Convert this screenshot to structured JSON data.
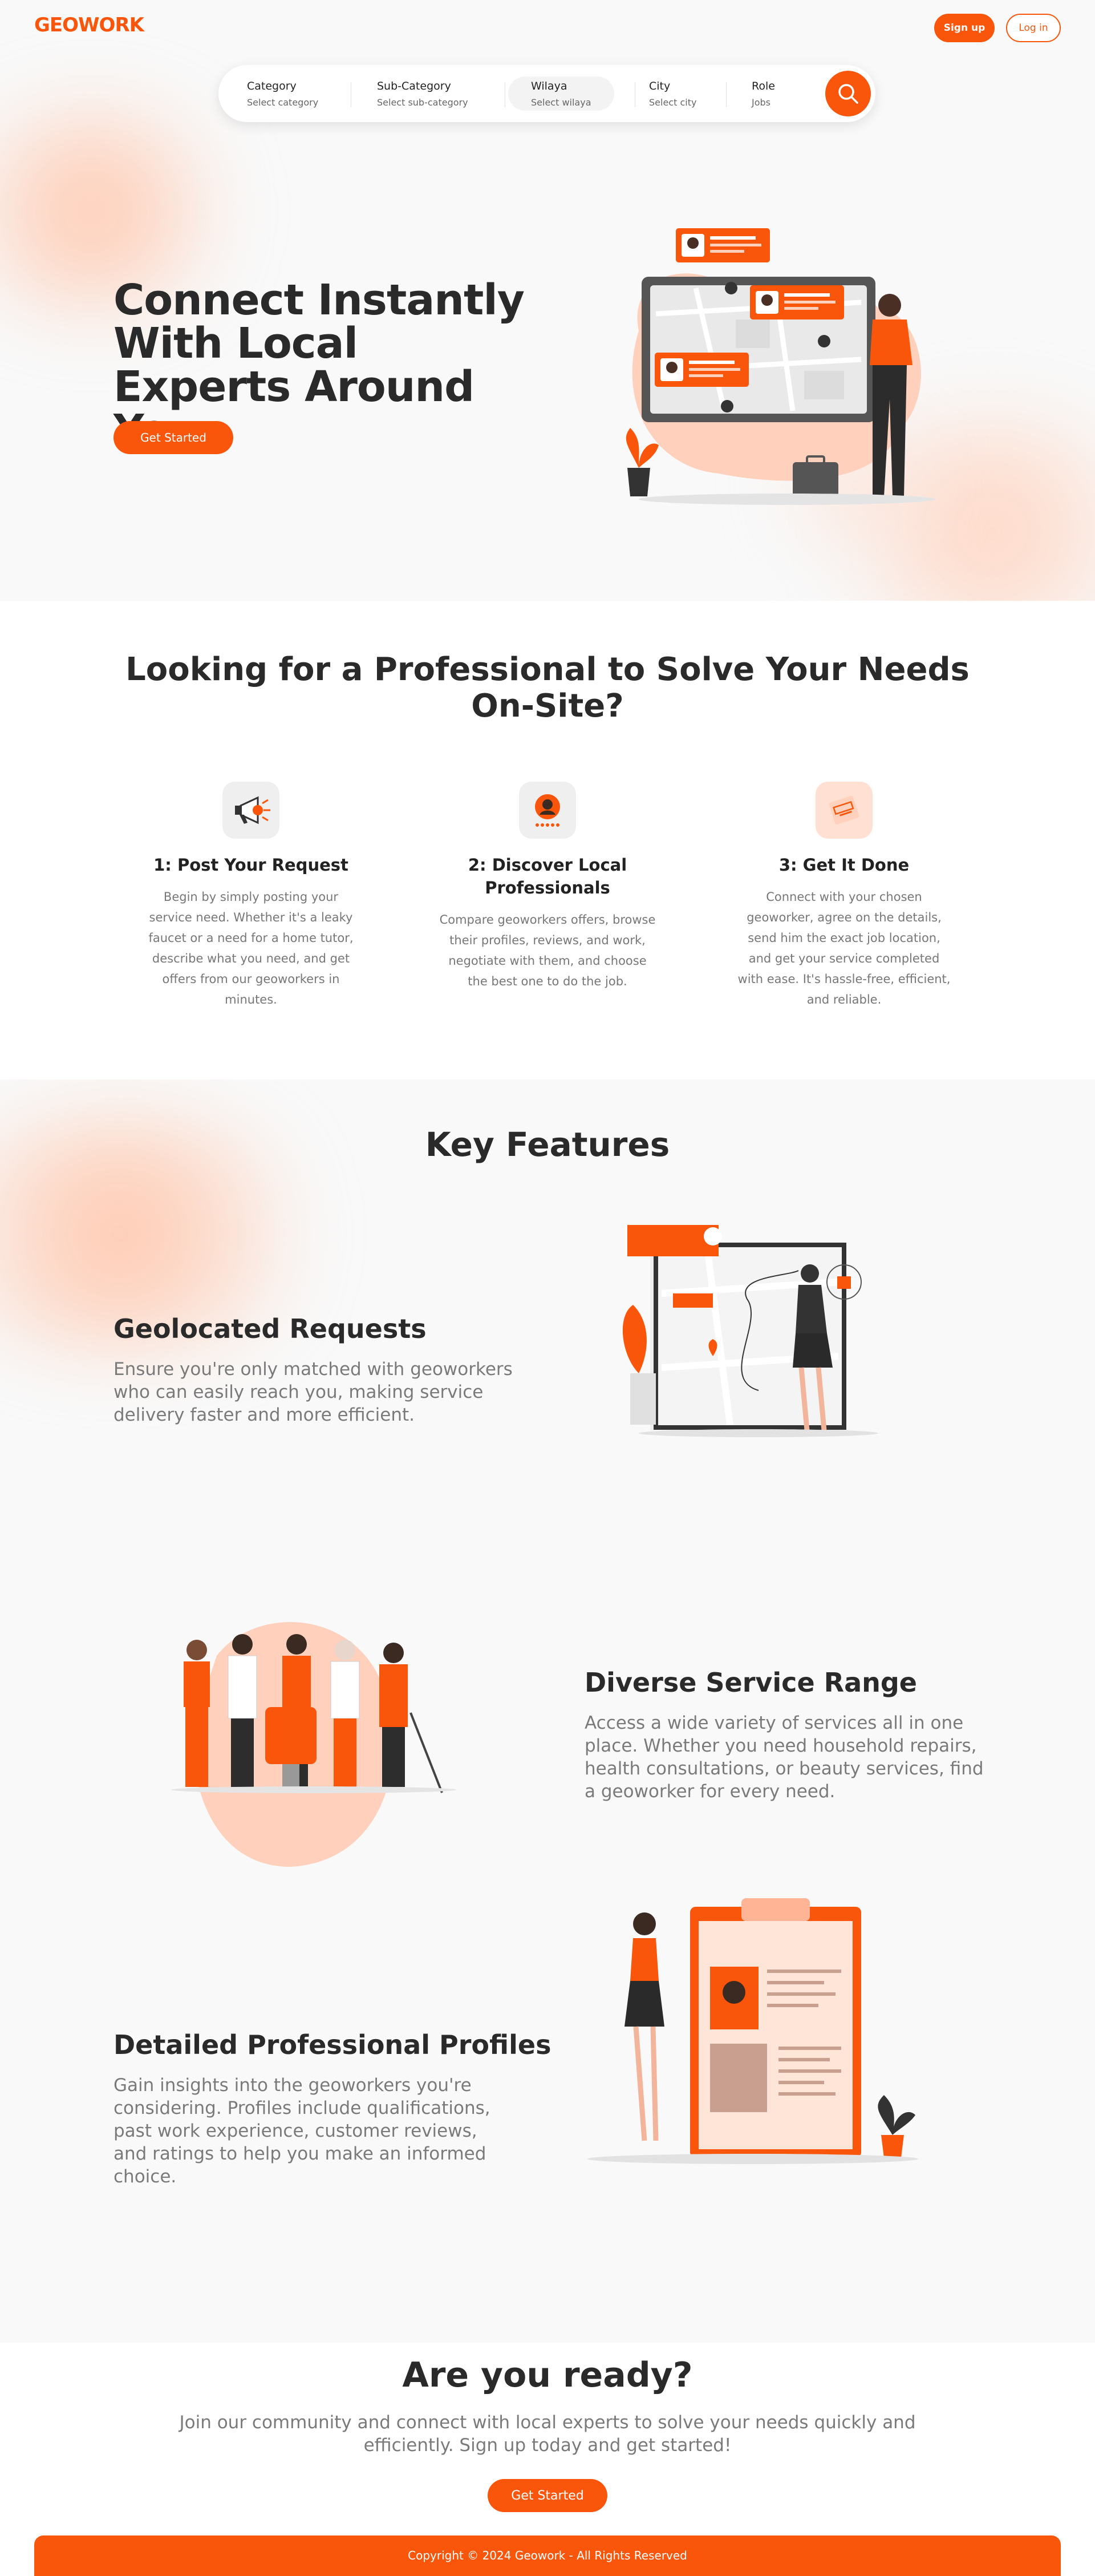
{
  "brand": {
    "logo": "GEOWORK",
    "accent": "#f9560b",
    "accent_light": "#ffd2bf"
  },
  "header": {
    "signup_label": "Sign up",
    "login_label": "Log in"
  },
  "search": {
    "fields": [
      {
        "label": "Category",
        "placeholder": "Select category"
      },
      {
        "label": "Sub-Category",
        "placeholder": "Select sub-category"
      },
      {
        "label": "Wilaya",
        "placeholder": "Select wilaya"
      },
      {
        "label": "City",
        "placeholder": "Select city"
      },
      {
        "label": "Role",
        "placeholder": "Jobs"
      }
    ],
    "button_icon": "search-icon"
  },
  "hero": {
    "title": "Connect Instantly With Local Experts Around You",
    "cta": "Get Started"
  },
  "how": {
    "title": "Looking for a Professional to Solve Your Needs On-Site?",
    "steps": [
      {
        "icon": "megaphone-icon",
        "title": "1: Post Your Request",
        "text": "Begin by simply posting your service need. Whether it's a leaky faucet or a need for a home tutor, describe what you need, and get offers from our geoworkers in minutes."
      },
      {
        "icon": "profile-rating-icon",
        "title": "2: Discover Local Professionals",
        "text": "Compare geoworkers offers, browse their profiles, reviews, and work, negotiate with them, and choose the best one to do the job."
      },
      {
        "icon": "done-stamp-icon",
        "title": "3: Get It Done",
        "text": "Connect with your chosen geoworker, agree on the details, send him the exact job location, and get your service completed with ease. It's hassle-free, efficient, and reliable."
      }
    ]
  },
  "features": {
    "title": "Key Features",
    "items": [
      {
        "title": "Geolocated Requests",
        "text": "Ensure you're only matched with geoworkers who can easily reach you, making service delivery faster and more efficient."
      },
      {
        "title": "Diverse Service Range",
        "text": "Access a wide variety of services all in one place. Whether you need household repairs, health consultations, or beauty services, find a geoworker for every need."
      },
      {
        "title": "Detailed Professional Profiles",
        "text": "Gain insights into the geoworkers you're considering. Profiles include qualifications, past work experience, customer reviews, and ratings to help you make an informed choice."
      }
    ]
  },
  "cta": {
    "title": "Are you ready?",
    "text": "Join our community and connect with local experts to solve your needs quickly and efficiently. Sign up today and get started!",
    "button": "Get Started"
  },
  "footer": {
    "text": "Copyright © 2024 Geowork - All Rights Reserved"
  }
}
